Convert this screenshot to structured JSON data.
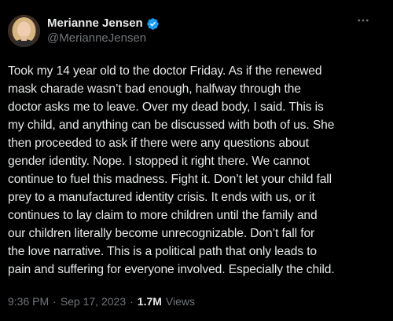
{
  "author": {
    "display_name": "Merianne Jensen",
    "handle": "@MerianneJensen",
    "verified": true
  },
  "tweet": {
    "lines": [
      "Took my 14 year old to the doctor Friday. As if the renewed",
      "mask charade wasn’t bad enough, halfway through the",
      "doctor asks me to leave. Over my dead body, I said. This is",
      "my child, and anything can be discussed with both of us. She",
      "then proceeded to ask if there were any questions about",
      "gender identity. Nope. I stopped it right there. We cannot",
      "continue to fuel this madness. Fight it. Don’t let your child fall",
      "prey to a manufactured identity crisis. It ends with us, or it",
      "continues to lay claim to more children until the family and",
      "our children literally become unrecognizable. Don’t fall for",
      "the love narrative. This is a political path that only leads to",
      "pain and suffering for everyone involved. Especially the child."
    ]
  },
  "meta": {
    "time": "9:36 PM",
    "separator": "·",
    "date": "Sep 17, 2023",
    "separator2": "·",
    "views_count": "1.7M",
    "views_label": "Views"
  },
  "colors": {
    "background": "#000000",
    "text_primary": "#e7e9ea",
    "text_secondary": "#71767b",
    "verified_blue": "#1d9bf0"
  },
  "icons": {
    "verified": "verified-badge-icon",
    "more": "more-options-icon"
  }
}
